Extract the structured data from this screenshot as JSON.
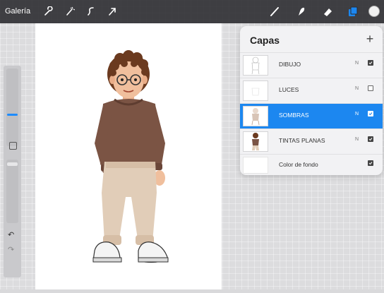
{
  "topbar": {
    "gallery_label": "Galería",
    "left_tools": [
      "wrench-icon",
      "magic-wand-icon",
      "selection-icon",
      "transform-arrow-icon"
    ],
    "right_tools": [
      "brush-icon",
      "smudge-icon",
      "eraser-icon",
      "layers-icon",
      "color-circle-icon"
    ]
  },
  "layers_panel": {
    "title": "Capas",
    "add_label": "+",
    "layers": [
      {
        "name": "DIBUJO",
        "mode": "N",
        "visible": true,
        "selected": false
      },
      {
        "name": "LUCES",
        "mode": "N",
        "visible": false,
        "selected": false
      },
      {
        "name": "SOMBRAS",
        "mode": "N",
        "visible": true,
        "selected": true
      },
      {
        "name": "TINTAS PLANAS",
        "mode": "N",
        "visible": true,
        "selected": false
      }
    ],
    "background": {
      "name": "Color de fondo",
      "visible": true
    }
  },
  "colors": {
    "accent": "#1c87f0",
    "topbar": "#2b2b2f"
  }
}
